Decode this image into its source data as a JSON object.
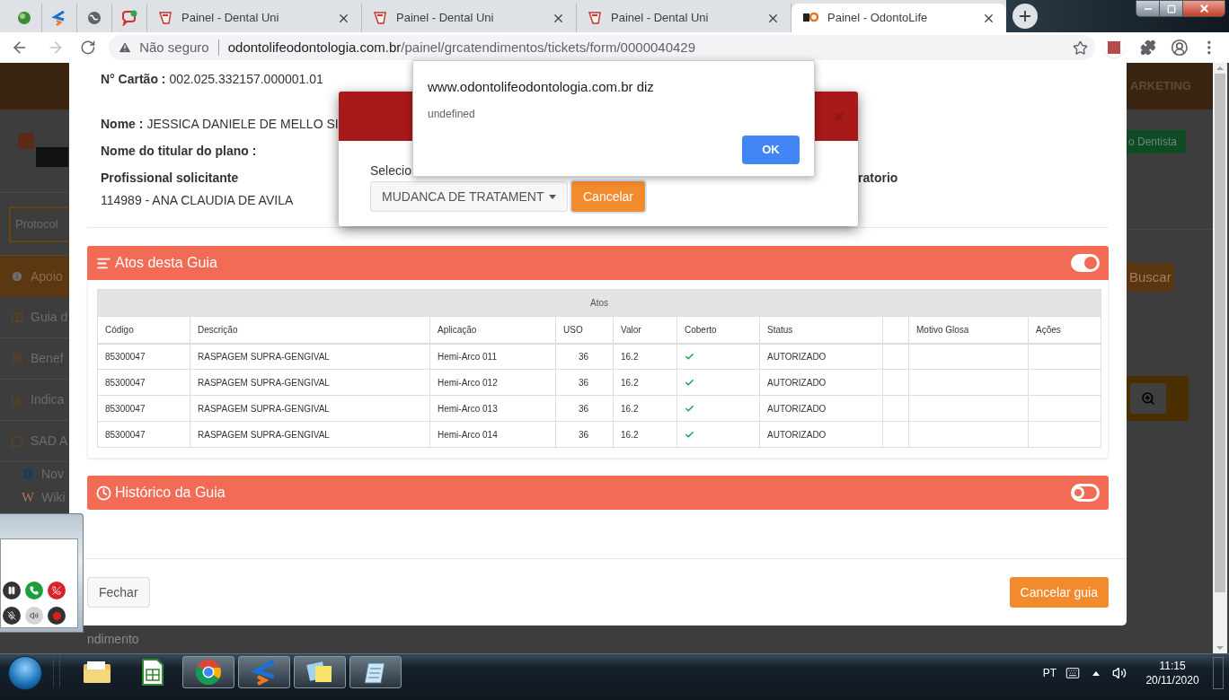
{
  "browser": {
    "tabs": [
      {
        "pinned": true,
        "selected": false
      },
      {
        "pinned": true,
        "selected": false
      },
      {
        "pinned": true,
        "selected": false
      },
      {
        "pinned": true,
        "selected": false
      },
      {
        "pinned": false,
        "title": "Painel - Dental Uni",
        "selected": false
      },
      {
        "pinned": false,
        "title": "Painel - Dental Uni",
        "selected": false
      },
      {
        "pinned": false,
        "title": "Painel - Dental Uni",
        "selected": false
      },
      {
        "pinned": false,
        "title": "Painel - OdontoLife",
        "selected": true
      }
    ],
    "security": "Não seguro",
    "url_host": "odontolifeodontologia.com.br",
    "url_path": "/painel/grcatendimentos/tickets/form/0000040429"
  },
  "background_page": {
    "sidebar_items": [
      {
        "kind": "field",
        "label": "Protocol"
      },
      {
        "kind": "item",
        "label": "Apoio",
        "selected": true
      },
      {
        "kind": "item",
        "label": "Guia d",
        "selected": false
      },
      {
        "kind": "item",
        "label": "Benef",
        "selected": false
      },
      {
        "kind": "item",
        "label": "Indica",
        "selected": false
      },
      {
        "kind": "item",
        "label": "SAD A",
        "selected": false
      },
      {
        "kind": "sub",
        "label": "Nov"
      },
      {
        "kind": "sub",
        "label": "Wiki",
        "glyph": "W"
      }
    ],
    "bottom_item": "ndimento",
    "menu": "ARKETING",
    "green_button": "o Dentista",
    "search_button": "Buscar"
  },
  "modal": {
    "card_label": "N° Cartão :",
    "card_value": "002.025.332157.000001.01",
    "name_label": "Nome :",
    "name_value": "JESSICA DANIELE DE MELLO SI",
    "holder_label": "Nome do titular do plano :",
    "professional_label": "Profissional solicitante",
    "professional_value": "114989 - ANA CLAUDIA DE AVILA",
    "lab_label": "ratorio",
    "panels": [
      {
        "kind": "acts",
        "title": "Atos desta Guia",
        "expanded": true
      },
      {
        "kind": "history",
        "title": "Histórico da Guia",
        "expanded": false
      }
    ],
    "table": {
      "caption": "Atos",
      "columns": [
        {
          "label": "Código"
        },
        {
          "label": "Descrição"
        },
        {
          "label": "Aplicação"
        },
        {
          "label": "USO"
        },
        {
          "label": "Valor"
        },
        {
          "label": "Coberto"
        },
        {
          "label": "Status"
        },
        {},
        {
          "label": "Motivo Glosa"
        },
        {
          "label": "Ações"
        }
      ],
      "rows": [
        {
          "codigo": "85300047",
          "descricao": "RASPAGEM SUPRA-GENGIVAL",
          "aplicacao": "Hemi-Arco 011",
          "uso": "36",
          "valor": "16.2",
          "coberto": true,
          "status": "AUTORIZADO"
        },
        {
          "codigo": "85300047",
          "descricao": "RASPAGEM SUPRA-GENGIVAL",
          "aplicacao": "Hemi-Arco 012",
          "uso": "36",
          "valor": "16.2",
          "coberto": true,
          "status": "AUTORIZADO"
        },
        {
          "codigo": "85300047",
          "descricao": "RASPAGEM SUPRA-GENGIVAL",
          "aplicacao": "Hemi-Arco 013",
          "uso": "36",
          "valor": "16.2",
          "coberto": true,
          "status": "AUTORIZADO"
        },
        {
          "codigo": "85300047",
          "descricao": "RASPAGEM SUPRA-GENGIVAL",
          "aplicacao": "Hemi-Arco 014",
          "uso": "36",
          "valor": "16.2",
          "coberto": true,
          "status": "AUTORIZADO"
        }
      ]
    },
    "close_button": "Fechar",
    "cancel_button": "Cancelar guia"
  },
  "confirm_dialog": {
    "label": "Selecio",
    "select_value": "MUDANCA DE TRATAMENT",
    "cancel_button": "Cancelar"
  },
  "alert": {
    "title": "www.odontolifeodontologia.com.br diz",
    "message": "undefined",
    "ok_button": "OK"
  },
  "taskbar": {
    "apps": [
      {
        "running": false
      },
      {
        "running": false
      },
      {
        "running": true
      },
      {
        "running": true
      },
      {
        "running": true
      },
      {
        "running": true
      }
    ],
    "language": "PT",
    "time": "11:15",
    "date": "20/11/2020"
  }
}
